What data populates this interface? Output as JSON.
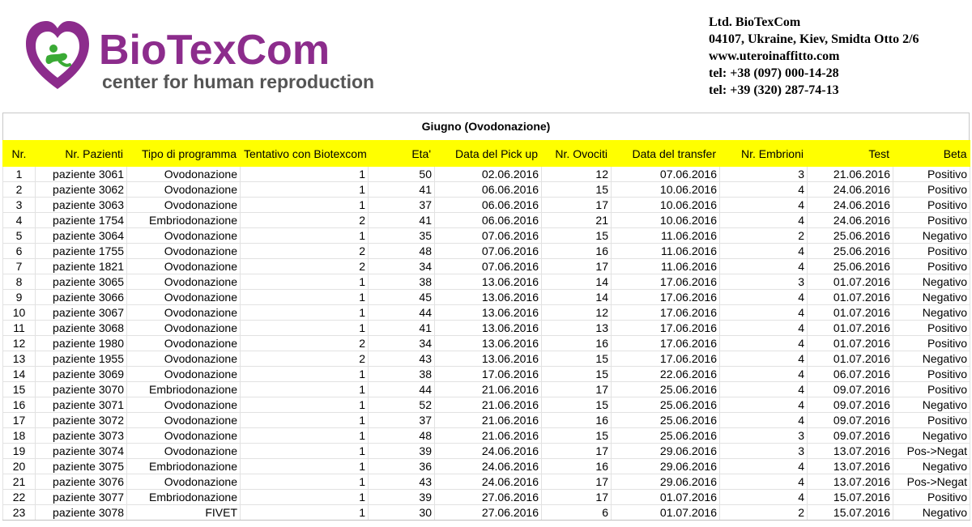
{
  "header": {
    "brand": "BioTexCom",
    "tagline": "center for human reproduction",
    "contact": [
      "Ltd. BioTexCom",
      "04107, Ukraine, Kiev, Smidta Otto 2/6",
      "www.uteroinaffitto.com",
      "tel: +38 (097) 000-14-28",
      "tel: +39 (320) 287-74-13"
    ],
    "colors": {
      "brand": "#8c2c8c",
      "accent": "#3aaa35",
      "header_row": "#ffff00"
    }
  },
  "table": {
    "title": "Giugno (Ovodonazione)",
    "columns": [
      "Nr.",
      "Nr. Pazienti",
      "Tipo di programma",
      "Tentativo con Biotexcom",
      "Eta'",
      "Data del Pick up",
      "Nr. Ovociti",
      "Data del transfer",
      "Nr. Embrioni",
      "Test",
      "Beta"
    ],
    "rows": [
      [
        "1",
        "paziente 3061",
        "Ovodonazione",
        "1",
        "50",
        "02.06.2016",
        "12",
        "07.06.2016",
        "3",
        "21.06.2016",
        "Positivo"
      ],
      [
        "2",
        "paziente 3062",
        "Ovodonazione",
        "1",
        "41",
        "06.06.2016",
        "15",
        "10.06.2016",
        "4",
        "24.06.2016",
        "Positivo"
      ],
      [
        "3",
        "paziente 3063",
        "Ovodonazione",
        "1",
        "37",
        "06.06.2016",
        "17",
        "10.06.2016",
        "4",
        "24.06.2016",
        "Positivo"
      ],
      [
        "4",
        "paziente 1754",
        "Embriodonazione",
        "2",
        "41",
        "06.06.2016",
        "21",
        "10.06.2016",
        "4",
        "24.06.2016",
        "Positivo"
      ],
      [
        "5",
        "paziente 3064",
        "Ovodonazione",
        "1",
        "35",
        "07.06.2016",
        "15",
        "11.06.2016",
        "2",
        "25.06.2016",
        "Negativo"
      ],
      [
        "6",
        "paziente 1755",
        "Ovodonazione",
        "2",
        "48",
        "07.06.2016",
        "16",
        "11.06.2016",
        "4",
        "25.06.2016",
        "Positivo"
      ],
      [
        "7",
        "paziente 1821",
        "Ovodonazione",
        "2",
        "34",
        "07.06.2016",
        "17",
        "11.06.2016",
        "4",
        "25.06.2016",
        "Positivo"
      ],
      [
        "8",
        "paziente 3065",
        "Ovodonazione",
        "1",
        "38",
        "13.06.2016",
        "14",
        "17.06.2016",
        "3",
        "01.07.2016",
        "Negativo"
      ],
      [
        "9",
        "paziente 3066",
        "Ovodonazione",
        "1",
        "45",
        "13.06.2016",
        "14",
        "17.06.2016",
        "4",
        "01.07.2016",
        "Negativo"
      ],
      [
        "10",
        "paziente 3067",
        "Ovodonazione",
        "1",
        "44",
        "13.06.2016",
        "12",
        "17.06.2016",
        "4",
        "01.07.2016",
        "Negativo"
      ],
      [
        "11",
        "paziente 3068",
        "Ovodonazione",
        "1",
        "41",
        "13.06.2016",
        "13",
        "17.06.2016",
        "4",
        "01.07.2016",
        "Positivo"
      ],
      [
        "12",
        "paziente 1980",
        "Ovodonazione",
        "2",
        "34",
        "13.06.2016",
        "16",
        "17.06.2016",
        "4",
        "01.07.2016",
        "Positivo"
      ],
      [
        "13",
        "paziente 1955",
        "Ovodonazione",
        "2",
        "43",
        "13.06.2016",
        "15",
        "17.06.2016",
        "4",
        "01.07.2016",
        "Negativo"
      ],
      [
        "14",
        "paziente 3069",
        "Ovodonazione",
        "1",
        "38",
        "17.06.2016",
        "15",
        "22.06.2016",
        "4",
        "06.07.2016",
        "Positivo"
      ],
      [
        "15",
        "paziente 3070",
        "Embriodonazione",
        "1",
        "44",
        "21.06.2016",
        "17",
        "25.06.2016",
        "4",
        "09.07.2016",
        "Positivo"
      ],
      [
        "16",
        "paziente 3071",
        "Ovodonazione",
        "1",
        "52",
        "21.06.2016",
        "15",
        "25.06.2016",
        "4",
        "09.07.2016",
        "Negativo"
      ],
      [
        "17",
        "paziente 3072",
        "Ovodonazione",
        "1",
        "37",
        "21.06.2016",
        "16",
        "25.06.2016",
        "4",
        "09.07.2016",
        "Positivo"
      ],
      [
        "18",
        "paziente 3073",
        "Ovodonazione",
        "1",
        "48",
        "21.06.2016",
        "15",
        "25.06.2016",
        "3",
        "09.07.2016",
        "Negativo"
      ],
      [
        "19",
        "paziente 3074",
        "Ovodonazione",
        "1",
        "39",
        "24.06.2016",
        "17",
        "29.06.2016",
        "3",
        "13.07.2016",
        "Pos->Negat"
      ],
      [
        "20",
        "paziente 3075",
        "Embriodonazione",
        "1",
        "36",
        "24.06.2016",
        "16",
        "29.06.2016",
        "4",
        "13.07.2016",
        "Negativo"
      ],
      [
        "21",
        "paziente 3076",
        "Ovodonazione",
        "1",
        "43",
        "24.06.2016",
        "17",
        "29.06.2016",
        "4",
        "13.07.2016",
        "Pos->Negat"
      ],
      [
        "22",
        "paziente 3077",
        "Embriodonazione",
        "1",
        "39",
        "27.06.2016",
        "17",
        "01.07.2016",
        "4",
        "15.07.2016",
        "Positivo"
      ],
      [
        "23",
        "paziente 3078",
        "FIVET",
        "1",
        "30",
        "27.06.2016",
        "6",
        "01.07.2016",
        "2",
        "15.07.2016",
        "Negativo"
      ]
    ]
  }
}
